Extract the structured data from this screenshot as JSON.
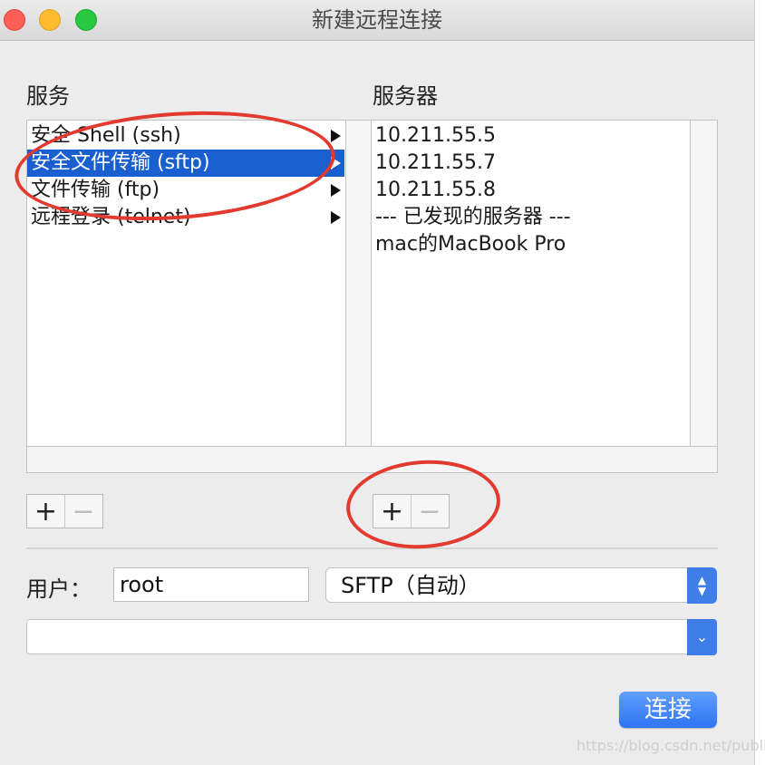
{
  "window": {
    "title": "新建远程连接"
  },
  "services": {
    "header": "服务",
    "items": [
      {
        "label": "安全 Shell (ssh)",
        "selected": false
      },
      {
        "label": "安全文件传输 (sftp)",
        "selected": true
      },
      {
        "label": "文件传输 (ftp)",
        "selected": false
      },
      {
        "label": "远程登录 (telnet)",
        "selected": false
      }
    ],
    "add_label": "+",
    "remove_label": "−"
  },
  "servers": {
    "header": "服务器",
    "items": [
      "10.211.55.5",
      "10.211.55.7",
      "10.211.55.8",
      "--- 已发现的服务器 ---",
      "mac的MacBook Pro"
    ],
    "add_label": "+",
    "remove_label": "−"
  },
  "connection": {
    "user_label": "用户：",
    "user_value": "root",
    "protocol_value": "SFTP（自动）",
    "host_value": "",
    "connect_label": "连接"
  },
  "watermark": "https://blog.csdn.net/publicc",
  "colors": {
    "annotation": "#e23a2f",
    "selection": "#1a5fd0",
    "accent": "#2f74f3"
  }
}
